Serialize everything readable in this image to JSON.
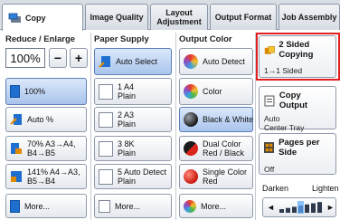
{
  "tabs": [
    {
      "label": "Copy",
      "active": true
    },
    {
      "label": "Image Quality",
      "active": false
    },
    {
      "label": "Layout Adjustment",
      "active": false
    },
    {
      "label": "Output Format",
      "active": false
    },
    {
      "label": "Job Assembly",
      "active": false
    }
  ],
  "reduce_enlarge": {
    "heading": "Reduce / Enlarge",
    "value": "100%",
    "minus": "−",
    "plus": "+",
    "presets": [
      {
        "label": "100%",
        "selected": true
      },
      {
        "label": "Auto %",
        "selected": false
      },
      {
        "label": "70% A3→A4, B4→B5",
        "line1": "70% A3→A4,",
        "line2": "B4→B5",
        "selected": false
      },
      {
        "label": "141% A4→A3, B5→B4",
        "line1": "141% A4→A3,",
        "line2": "B5→B4",
        "selected": false
      },
      {
        "label": "More...",
        "selected": false
      }
    ]
  },
  "paper_supply": {
    "heading": "Paper Supply",
    "options": [
      {
        "tray": "",
        "size": "Auto Select",
        "type": "",
        "selected": true
      },
      {
        "tray": "1",
        "size": "A4",
        "type": "Plain",
        "selected": false
      },
      {
        "tray": "2",
        "size": "A3",
        "type": "Plain",
        "selected": false
      },
      {
        "tray": "3",
        "size": "8K",
        "type": "Plain",
        "selected": false
      },
      {
        "tray": "5",
        "size": "Auto Detect",
        "type": "Plain",
        "selected": false
      },
      {
        "tray": "",
        "size": "More...",
        "type": "",
        "selected": false
      }
    ]
  },
  "output_color": {
    "heading": "Output Color",
    "options": [
      {
        "line1": "Auto Detect",
        "line2": "",
        "selected": false
      },
      {
        "line1": "Color",
        "line2": "",
        "selected": false
      },
      {
        "line1": "Black & White",
        "line2": "",
        "selected": true
      },
      {
        "line1": "Dual Color",
        "line2": "Red / Black",
        "selected": false
      },
      {
        "line1": "Single Color",
        "line2": "Red",
        "selected": false
      },
      {
        "line1": "More...",
        "line2": "",
        "selected": false
      }
    ]
  },
  "right_panel": {
    "two_sided": {
      "title": "2 Sided Copying",
      "value": "1→1 Sided"
    },
    "copy_output": {
      "title": "Copy Output",
      "value_line1": "Auto",
      "value_line2": "Center Tray"
    },
    "pages_per_side": {
      "title": "Pages per Side",
      "value": "Off"
    },
    "density": {
      "left_label": "Darken",
      "right_label": "Lighten",
      "left_arrow": "◄",
      "right_arrow": "►",
      "level": 0.5
    }
  },
  "colors": {
    "selected_bg": "#a9c4ec",
    "tab_bar": "#d9dde4",
    "highlight_frame": "#e02020",
    "doc_blue": "#1e6fd0"
  }
}
